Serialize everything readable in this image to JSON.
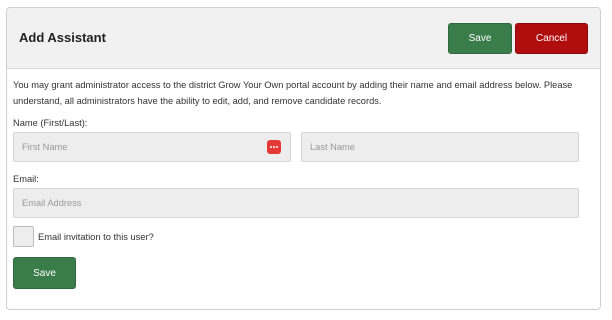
{
  "dialog": {
    "title": "Add Assistant",
    "save_label": "Save",
    "cancel_label": "Cancel"
  },
  "form": {
    "intro_text": "You may grant administrator access to the district Grow Your Own portal account by adding their name and email address below. Please understand, all administrators have the ability to edit, add, and remove candidate records.",
    "name_label": "Name (First/Last):",
    "first_name": {
      "value": "",
      "placeholder": "First Name"
    },
    "last_name": {
      "value": "",
      "placeholder": "Last Name"
    },
    "email_label": "Email:",
    "email": {
      "value": "",
      "placeholder": "Email Address"
    },
    "invite_checkbox_label": "Email invitation to this user?",
    "invite_checked": false,
    "submit_label": "Save"
  },
  "colors": {
    "save_green": "#3a7d4a",
    "cancel_red": "#b00d0f",
    "header_bg": "#f1f1f1",
    "input_bg": "#ededed",
    "password_manager_icon": "#e53935"
  },
  "icons": {
    "first_name_field_icon": "password-manager-icon"
  }
}
